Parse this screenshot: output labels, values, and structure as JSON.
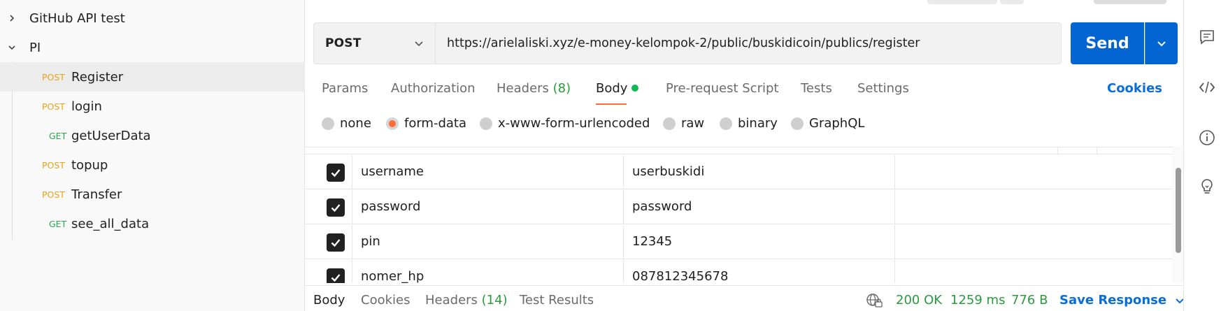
{
  "sidebar": {
    "folders": [
      {
        "label": "GitHub API test",
        "expanded": false
      },
      {
        "label": "PI",
        "expanded": true
      }
    ],
    "requests": [
      {
        "method": "POST",
        "label": "Register",
        "active": true
      },
      {
        "method": "POST",
        "label": "login"
      },
      {
        "method": "GET",
        "label": "getUserData"
      },
      {
        "method": "POST",
        "label": "topup"
      },
      {
        "method": "POST",
        "label": "Transfer"
      },
      {
        "method": "GET",
        "label": "see_all_data"
      }
    ]
  },
  "request": {
    "method": "POST",
    "url": "https://arielaliski.xyz/e-money-kelompok-2/public/buskidicoin/publics/register",
    "send_label": "Send"
  },
  "tabs": {
    "params": "Params",
    "authorization": "Authorization",
    "headers_label": "Headers",
    "headers_count": "(8)",
    "body": "Body",
    "prerequest": "Pre-request Script",
    "tests": "Tests",
    "settings": "Settings",
    "cookies": "Cookies"
  },
  "body_types": {
    "none": "none",
    "form_data": "form-data",
    "urlencoded": "x-www-form-urlencoded",
    "raw": "raw",
    "binary": "binary",
    "graphql": "GraphQL",
    "selected": "form-data"
  },
  "form_rows": [
    {
      "key": "username",
      "value": "userbuskidi",
      "checked": true
    },
    {
      "key": "password",
      "value": "password",
      "checked": true
    },
    {
      "key": "pin",
      "value": "12345",
      "checked": true
    },
    {
      "key": "nomer_hp",
      "value": "087812345678",
      "checked": true
    }
  ],
  "response": {
    "tab_body": "Body",
    "tab_cookies": "Cookies",
    "tab_headers_label": "Headers",
    "tab_headers_count": "(14)",
    "tab_test_results": "Test Results",
    "status": "200 OK",
    "time": "1259 ms",
    "size": "776 B",
    "save": "Save Response"
  },
  "colors": {
    "accent_blue": "#0265d2",
    "post": "#e9a31a",
    "get": "#2ea44f",
    "tab_underline": "#ff6c37",
    "status_green": "#2a9a3d"
  },
  "icons": [
    "chevron-right-icon",
    "chevron-down-icon",
    "checkbox-checked-icon",
    "globe-lock-icon",
    "comment-icon",
    "code-icon",
    "info-icon",
    "lightbulb-icon"
  ]
}
